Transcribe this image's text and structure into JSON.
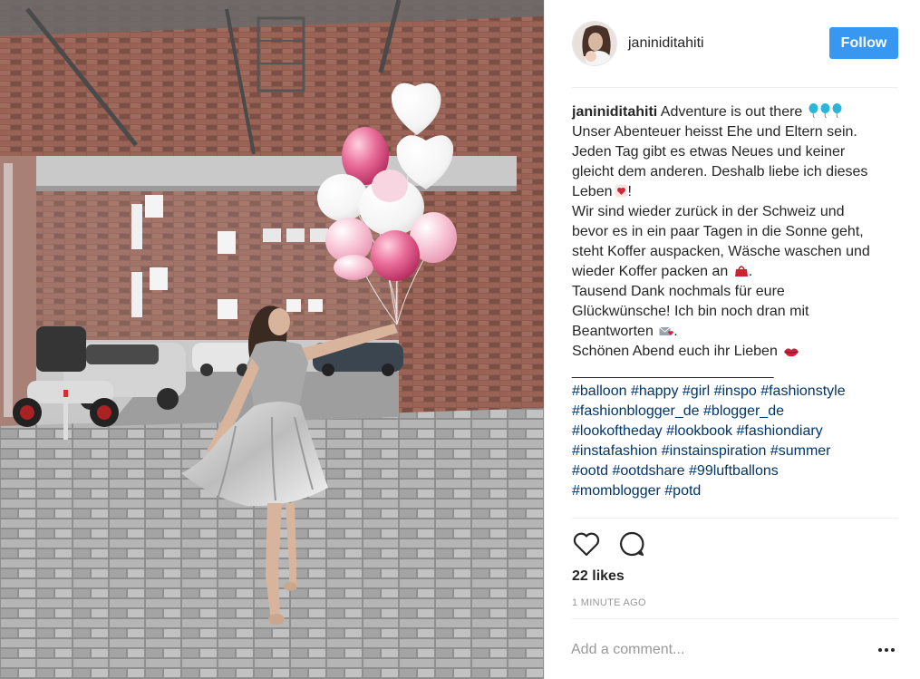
{
  "post": {
    "username": "janiniditahiti",
    "follow_label": "Follow",
    "caption_lines": [
      "Adventure is out there",
      "Unser Abenteuer heisst Ehe und Eltern sein.",
      "Jeden Tag gibt es etwas Neues und keiner",
      "gleicht dem anderen. Deshalb liebe ich dieses",
      "Leben",
      "!",
      "Wir sind wieder zurück in der Schweiz und",
      "bevor es in ein paar Tagen in die Sonne geht,",
      "steht Koffer auspacken, Wäsche waschen und",
      "wieder Koffer packen an",
      ".",
      "Tausend Dank nochmals für eure",
      "Glückwünsche! Ich bin noch dran mit",
      "Beantworten",
      ".",
      "Schönen Abend euch ihr Lieben",
      "_________________________"
    ],
    "hashtag_lines": [
      [
        "#balloon",
        "#happy",
        "#girl",
        "#inspo",
        "#fashionstyle"
      ],
      [
        "#fashionblogger_de",
        "#blogger_de"
      ],
      [
        "#lookoftheday",
        "#lookbook",
        "#fashiondiary"
      ],
      [
        "#instafashion",
        "#instainspiration",
        "#summer"
      ],
      [
        "#ootd",
        "#ootdshare",
        "#99luftballons"
      ],
      [
        "#momblogger",
        "#potd"
      ]
    ],
    "likes": "22 likes",
    "timestamp": "1 MINUTE AGO",
    "comment_placeholder": "Add a comment...",
    "icons": {
      "like": "heart-outline-icon",
      "comment": "speech-bubble-icon",
      "more": "ellipsis-icon"
    },
    "colors": {
      "follow_button": "#3897f0",
      "hashtag": "#003569",
      "muted": "#999999"
    }
  }
}
